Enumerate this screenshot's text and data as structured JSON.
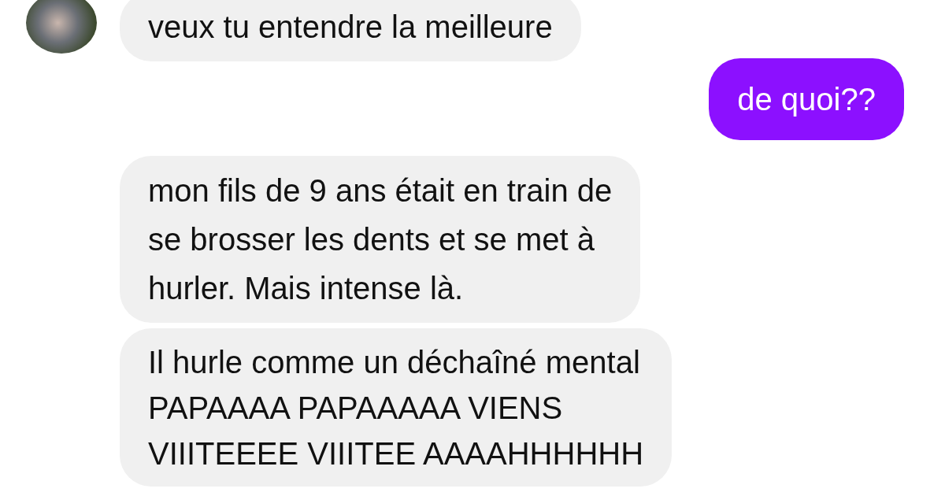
{
  "messages": [
    {
      "kind": "received",
      "text": "veux tu entendre la meilleure"
    },
    {
      "kind": "sent",
      "text": "de quoi??"
    },
    {
      "kind": "received",
      "text": "mon fils de 9 ans était en train de\nse brosser les dents et se met à\nhurler. Mais intense là."
    },
    {
      "kind": "received",
      "text": "Il hurle comme un déchaîné mental\nPAPAAAA PAPAAAAA VIENS\nVIIITEEEE VIIITEE AAAAHHHHHH"
    }
  ]
}
